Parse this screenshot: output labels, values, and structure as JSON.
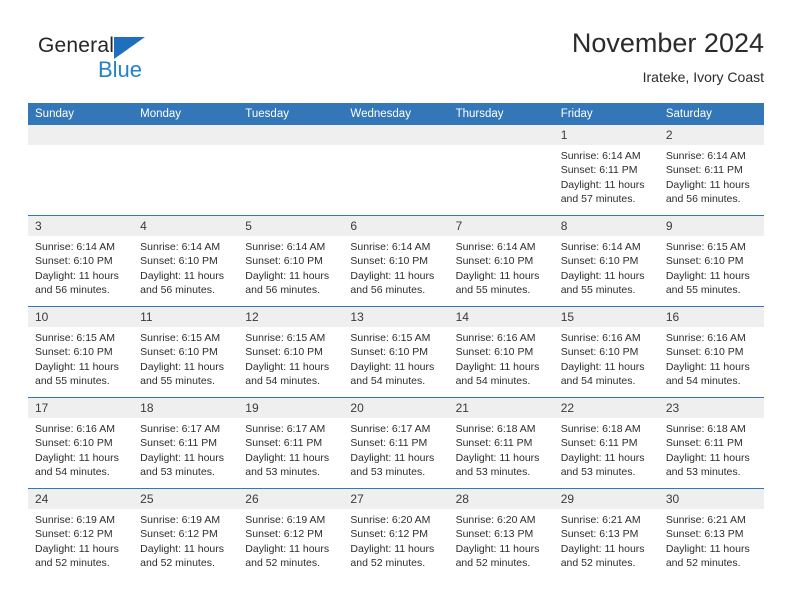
{
  "brand": {
    "name_part1": "General",
    "name_part2": "Blue",
    "triangle_color": "#1f6fbe",
    "blue_color": "#2382c8"
  },
  "header": {
    "title": "November 2024",
    "subtitle": "Irateke, Ivory Coast"
  },
  "theme": {
    "header_blue": "#3377b8",
    "daynum_band": "#efefef",
    "text": "#2d2d2d"
  },
  "weekdays": [
    "Sunday",
    "Monday",
    "Tuesday",
    "Wednesday",
    "Thursday",
    "Friday",
    "Saturday"
  ],
  "weeks": [
    [
      {
        "day": "",
        "empty": true
      },
      {
        "day": "",
        "empty": true
      },
      {
        "day": "",
        "empty": true
      },
      {
        "day": "",
        "empty": true
      },
      {
        "day": "",
        "empty": true
      },
      {
        "day": "1",
        "sunrise": "Sunrise: 6:14 AM",
        "sunset": "Sunset: 6:11 PM",
        "daylight1": "Daylight: 11 hours",
        "daylight2": "and 57 minutes."
      },
      {
        "day": "2",
        "sunrise": "Sunrise: 6:14 AM",
        "sunset": "Sunset: 6:11 PM",
        "daylight1": "Daylight: 11 hours",
        "daylight2": "and 56 minutes."
      }
    ],
    [
      {
        "day": "3",
        "sunrise": "Sunrise: 6:14 AM",
        "sunset": "Sunset: 6:10 PM",
        "daylight1": "Daylight: 11 hours",
        "daylight2": "and 56 minutes."
      },
      {
        "day": "4",
        "sunrise": "Sunrise: 6:14 AM",
        "sunset": "Sunset: 6:10 PM",
        "daylight1": "Daylight: 11 hours",
        "daylight2": "and 56 minutes."
      },
      {
        "day": "5",
        "sunrise": "Sunrise: 6:14 AM",
        "sunset": "Sunset: 6:10 PM",
        "daylight1": "Daylight: 11 hours",
        "daylight2": "and 56 minutes."
      },
      {
        "day": "6",
        "sunrise": "Sunrise: 6:14 AM",
        "sunset": "Sunset: 6:10 PM",
        "daylight1": "Daylight: 11 hours",
        "daylight2": "and 56 minutes."
      },
      {
        "day": "7",
        "sunrise": "Sunrise: 6:14 AM",
        "sunset": "Sunset: 6:10 PM",
        "daylight1": "Daylight: 11 hours",
        "daylight2": "and 55 minutes."
      },
      {
        "day": "8",
        "sunrise": "Sunrise: 6:14 AM",
        "sunset": "Sunset: 6:10 PM",
        "daylight1": "Daylight: 11 hours",
        "daylight2": "and 55 minutes."
      },
      {
        "day": "9",
        "sunrise": "Sunrise: 6:15 AM",
        "sunset": "Sunset: 6:10 PM",
        "daylight1": "Daylight: 11 hours",
        "daylight2": "and 55 minutes."
      }
    ],
    [
      {
        "day": "10",
        "sunrise": "Sunrise: 6:15 AM",
        "sunset": "Sunset: 6:10 PM",
        "daylight1": "Daylight: 11 hours",
        "daylight2": "and 55 minutes."
      },
      {
        "day": "11",
        "sunrise": "Sunrise: 6:15 AM",
        "sunset": "Sunset: 6:10 PM",
        "daylight1": "Daylight: 11 hours",
        "daylight2": "and 55 minutes."
      },
      {
        "day": "12",
        "sunrise": "Sunrise: 6:15 AM",
        "sunset": "Sunset: 6:10 PM",
        "daylight1": "Daylight: 11 hours",
        "daylight2": "and 54 minutes."
      },
      {
        "day": "13",
        "sunrise": "Sunrise: 6:15 AM",
        "sunset": "Sunset: 6:10 PM",
        "daylight1": "Daylight: 11 hours",
        "daylight2": "and 54 minutes."
      },
      {
        "day": "14",
        "sunrise": "Sunrise: 6:16 AM",
        "sunset": "Sunset: 6:10 PM",
        "daylight1": "Daylight: 11 hours",
        "daylight2": "and 54 minutes."
      },
      {
        "day": "15",
        "sunrise": "Sunrise: 6:16 AM",
        "sunset": "Sunset: 6:10 PM",
        "daylight1": "Daylight: 11 hours",
        "daylight2": "and 54 minutes."
      },
      {
        "day": "16",
        "sunrise": "Sunrise: 6:16 AM",
        "sunset": "Sunset: 6:10 PM",
        "daylight1": "Daylight: 11 hours",
        "daylight2": "and 54 minutes."
      }
    ],
    [
      {
        "day": "17",
        "sunrise": "Sunrise: 6:16 AM",
        "sunset": "Sunset: 6:10 PM",
        "daylight1": "Daylight: 11 hours",
        "daylight2": "and 54 minutes."
      },
      {
        "day": "18",
        "sunrise": "Sunrise: 6:17 AM",
        "sunset": "Sunset: 6:11 PM",
        "daylight1": "Daylight: 11 hours",
        "daylight2": "and 53 minutes."
      },
      {
        "day": "19",
        "sunrise": "Sunrise: 6:17 AM",
        "sunset": "Sunset: 6:11 PM",
        "daylight1": "Daylight: 11 hours",
        "daylight2": "and 53 minutes."
      },
      {
        "day": "20",
        "sunrise": "Sunrise: 6:17 AM",
        "sunset": "Sunset: 6:11 PM",
        "daylight1": "Daylight: 11 hours",
        "daylight2": "and 53 minutes."
      },
      {
        "day": "21",
        "sunrise": "Sunrise: 6:18 AM",
        "sunset": "Sunset: 6:11 PM",
        "daylight1": "Daylight: 11 hours",
        "daylight2": "and 53 minutes."
      },
      {
        "day": "22",
        "sunrise": "Sunrise: 6:18 AM",
        "sunset": "Sunset: 6:11 PM",
        "daylight1": "Daylight: 11 hours",
        "daylight2": "and 53 minutes."
      },
      {
        "day": "23",
        "sunrise": "Sunrise: 6:18 AM",
        "sunset": "Sunset: 6:11 PM",
        "daylight1": "Daylight: 11 hours",
        "daylight2": "and 53 minutes."
      }
    ],
    [
      {
        "day": "24",
        "sunrise": "Sunrise: 6:19 AM",
        "sunset": "Sunset: 6:12 PM",
        "daylight1": "Daylight: 11 hours",
        "daylight2": "and 52 minutes."
      },
      {
        "day": "25",
        "sunrise": "Sunrise: 6:19 AM",
        "sunset": "Sunset: 6:12 PM",
        "daylight1": "Daylight: 11 hours",
        "daylight2": "and 52 minutes."
      },
      {
        "day": "26",
        "sunrise": "Sunrise: 6:19 AM",
        "sunset": "Sunset: 6:12 PM",
        "daylight1": "Daylight: 11 hours",
        "daylight2": "and 52 minutes."
      },
      {
        "day": "27",
        "sunrise": "Sunrise: 6:20 AM",
        "sunset": "Sunset: 6:12 PM",
        "daylight1": "Daylight: 11 hours",
        "daylight2": "and 52 minutes."
      },
      {
        "day": "28",
        "sunrise": "Sunrise: 6:20 AM",
        "sunset": "Sunset: 6:13 PM",
        "daylight1": "Daylight: 11 hours",
        "daylight2": "and 52 minutes."
      },
      {
        "day": "29",
        "sunrise": "Sunrise: 6:21 AM",
        "sunset": "Sunset: 6:13 PM",
        "daylight1": "Daylight: 11 hours",
        "daylight2": "and 52 minutes."
      },
      {
        "day": "30",
        "sunrise": "Sunrise: 6:21 AM",
        "sunset": "Sunset: 6:13 PM",
        "daylight1": "Daylight: 11 hours",
        "daylight2": "and 52 minutes."
      }
    ]
  ]
}
